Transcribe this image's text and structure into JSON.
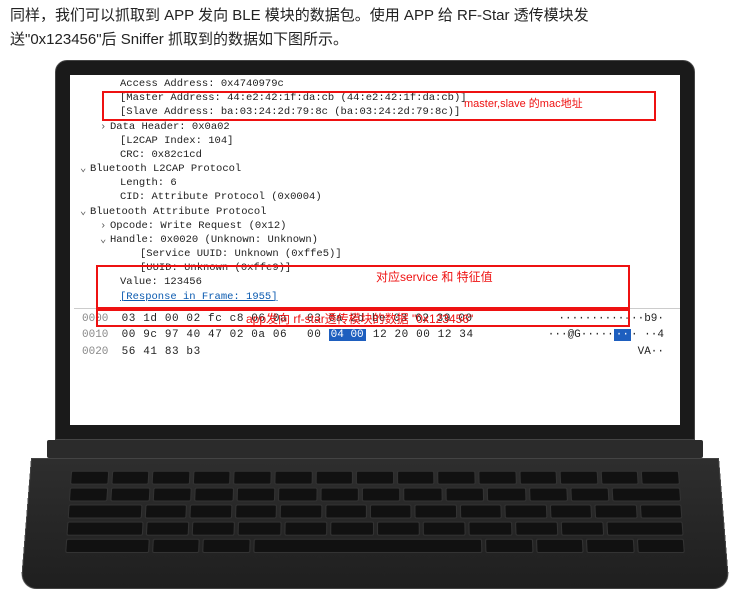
{
  "intro": {
    "line1": "同样，我们可以抓取到 APP 发向 BLE 模块的数据包。使用 APP 给 RF-Star 透传模块发",
    "line2": "送\"0x123456\"后 Sniffer 抓取到的数据如下图所示。"
  },
  "protocol": {
    "access_address_label": "Access Address: 0x4740979c",
    "master_address": "[Master Address: 44:e2:42:1f:da:cb (44:e2:42:1f:da:cb)]",
    "slave_address": "[Slave Address: ba:03:24:2d:79:8c (ba:03:24:2d:79:8c)]",
    "data_header": "Data Header: 0x0a02",
    "l2cap_index": "[L2CAP Index: 104]",
    "crc": "CRC: 0x82c1cd",
    "l2cap_title": "Bluetooth L2CAP Protocol",
    "l2cap_length": "Length: 6",
    "l2cap_cid": "CID: Attribute Protocol (0x0004)",
    "att_title": "Bluetooth Attribute Protocol",
    "opcode": "Opcode: Write Request (0x12)",
    "handle": "Handle: 0x0020 (Unknown: Unknown)",
    "service_uuid": "[Service UUID: Unknown (0xffe5)]",
    "uuid": "[UUID: Unknown (0xffe9)]",
    "value": "Value: 123456",
    "response": "[Response in Frame: 1955]"
  },
  "annotations": {
    "mac_label": "master,slave 的mac地址",
    "service_label": "对应service 和 特征值",
    "data_label": "app发向 rf-star透传模块的数据 \"0x123456\""
  },
  "hexdump": {
    "rows": [
      {
        "offset": "0000",
        "bytes_a": "03 1d 00 02 fc c8 06 0a",
        "bytes_b": "03 0a 2d be 03 62 39 00",
        "ascii": "··········-··b9·"
      },
      {
        "offset": "0010",
        "bytes_a": "00 9c 97 40 47 02 0a 06",
        "bytes_b_pre": "00 ",
        "bytes_hl": "04 00",
        "bytes_b_post": " 12 20 00 12 34",
        "ascii_pre": "···@G·····",
        "ascii_hl": "··",
        "ascii_post": "· ··4"
      },
      {
        "offset": "0020",
        "bytes_a": "56 41 83 b3",
        "bytes_b": "",
        "ascii": "VA··"
      }
    ]
  }
}
